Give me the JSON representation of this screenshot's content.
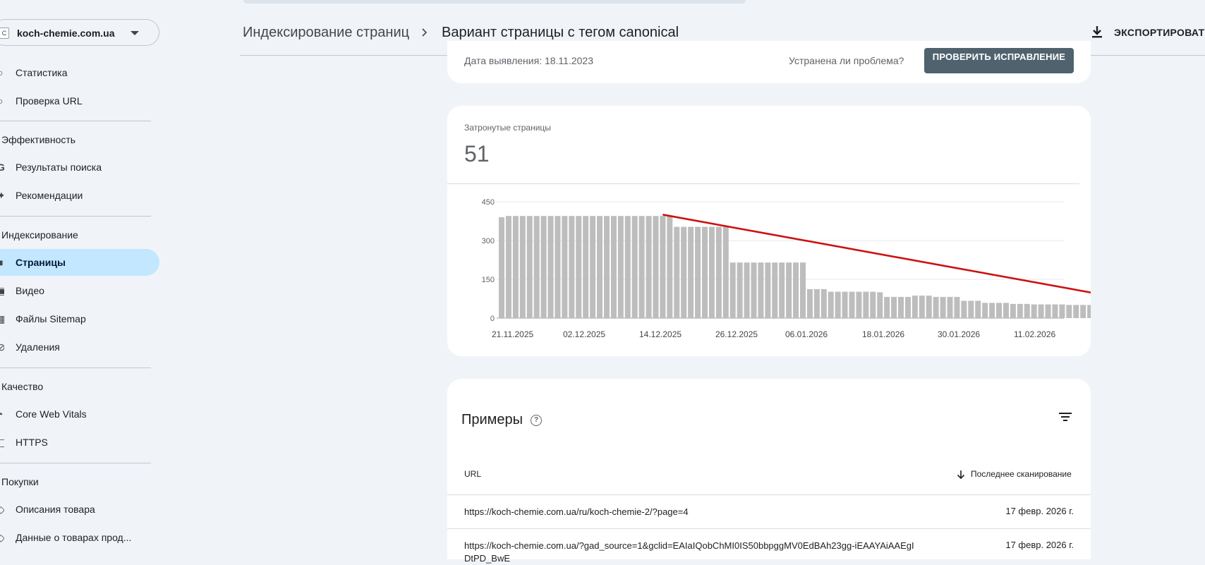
{
  "sidebar": {
    "property_name": "koch-chemie.com.ua",
    "items": [
      {
        "label": "Статистика",
        "icon": "stats-icon"
      },
      {
        "label": "Проверка URL",
        "icon": "search-icon"
      },
      {
        "section": "Эффективность"
      },
      {
        "label": "Результаты поиска",
        "icon": "google-icon"
      },
      {
        "label": "Рекомендации",
        "icon": "recommendations-icon"
      },
      {
        "section": "Индексирование"
      },
      {
        "label": "Страницы",
        "icon": "pages-icon",
        "active": true
      },
      {
        "label": "Видео",
        "icon": "video-icon"
      },
      {
        "label": "Файлы Sitemap",
        "icon": "sitemap-icon"
      },
      {
        "label": "Удаления",
        "icon": "removals-icon"
      },
      {
        "section": "Качество"
      },
      {
        "label": "Core Web Vitals",
        "icon": "speed-icon"
      },
      {
        "label": "HTTPS",
        "icon": "lock-icon"
      },
      {
        "section": "Покупки"
      },
      {
        "label": "Описания товара",
        "icon": "tag-icon"
      },
      {
        "label": "Данные о товарах прод...",
        "icon": "merchant-icon"
      }
    ]
  },
  "header": {
    "breadcrumb_parent": "Индексирование страниц",
    "breadcrumb_separator": ">",
    "breadcrumb_current": "Вариант страницы с тегом canonical",
    "export_label": "ЭКСПОРТИРОВАТЬ"
  },
  "status_card": {
    "detected": "Дата выявления: 18.11.2023",
    "fixed_question": "Устранена ли проблема?",
    "validate_button": "ПРОВЕРИТЬ ИСПРАВЛЕНИЕ"
  },
  "affected": {
    "label": "Затронутые страницы",
    "value": "51"
  },
  "chart_data": {
    "type": "bar",
    "ylim": [
      0,
      450
    ],
    "y_ticks": [
      0,
      150,
      300,
      450
    ],
    "x_tick_labels": [
      "21.11.2025",
      "02.12.2025",
      "14.12.2025",
      "26.12.2025",
      "06.01.2026",
      "18.01.2026",
      "30.01.2026",
      "11.02.2026"
    ],
    "values": [
      390,
      395,
      395,
      395,
      395,
      395,
      395,
      395,
      395,
      395,
      395,
      395,
      395,
      395,
      395,
      395,
      395,
      395,
      395,
      395,
      395,
      395,
      395,
      395,
      395,
      353,
      353,
      353,
      353,
      353,
      353,
      353,
      353,
      215,
      215,
      215,
      215,
      215,
      215,
      215,
      215,
      215,
      215,
      215,
      112,
      112,
      112,
      102,
      102,
      102,
      102,
      102,
      102,
      102,
      100,
      82,
      82,
      82,
      82,
      87,
      87,
      87,
      82,
      82,
      82,
      82,
      67,
      67,
      67,
      59,
      59,
      59,
      59,
      55,
      55,
      55,
      53,
      53,
      53,
      53,
      53,
      51,
      51,
      51,
      51,
      51,
      51,
      51,
      51,
      51
    ],
    "bar_color": "#bdbdbd",
    "annotation": {
      "type": "arrow",
      "color": "#cc1111",
      "from": {
        "bar": 23,
        "value": 400
      },
      "to": {
        "bar": 88,
        "value": 78
      }
    }
  },
  "examples": {
    "title": "Примеры",
    "col_url": "URL",
    "col_last_crawl": "Последнее сканирование",
    "rows": [
      {
        "url": "https://koch-chemie.com.ua/ru/koch-chemie-2/?page=4",
        "date": "17 февр. 2026 г."
      },
      {
        "url": "https://koch-chemie.com.ua/?gad_source=1&gclid=EAIaIQobChMI0IS50bbpggMV0EdBAh23gg-iEAAYAiAAEgI DtPD_BwE",
        "date": "17 февр. 2026 г."
      }
    ]
  }
}
